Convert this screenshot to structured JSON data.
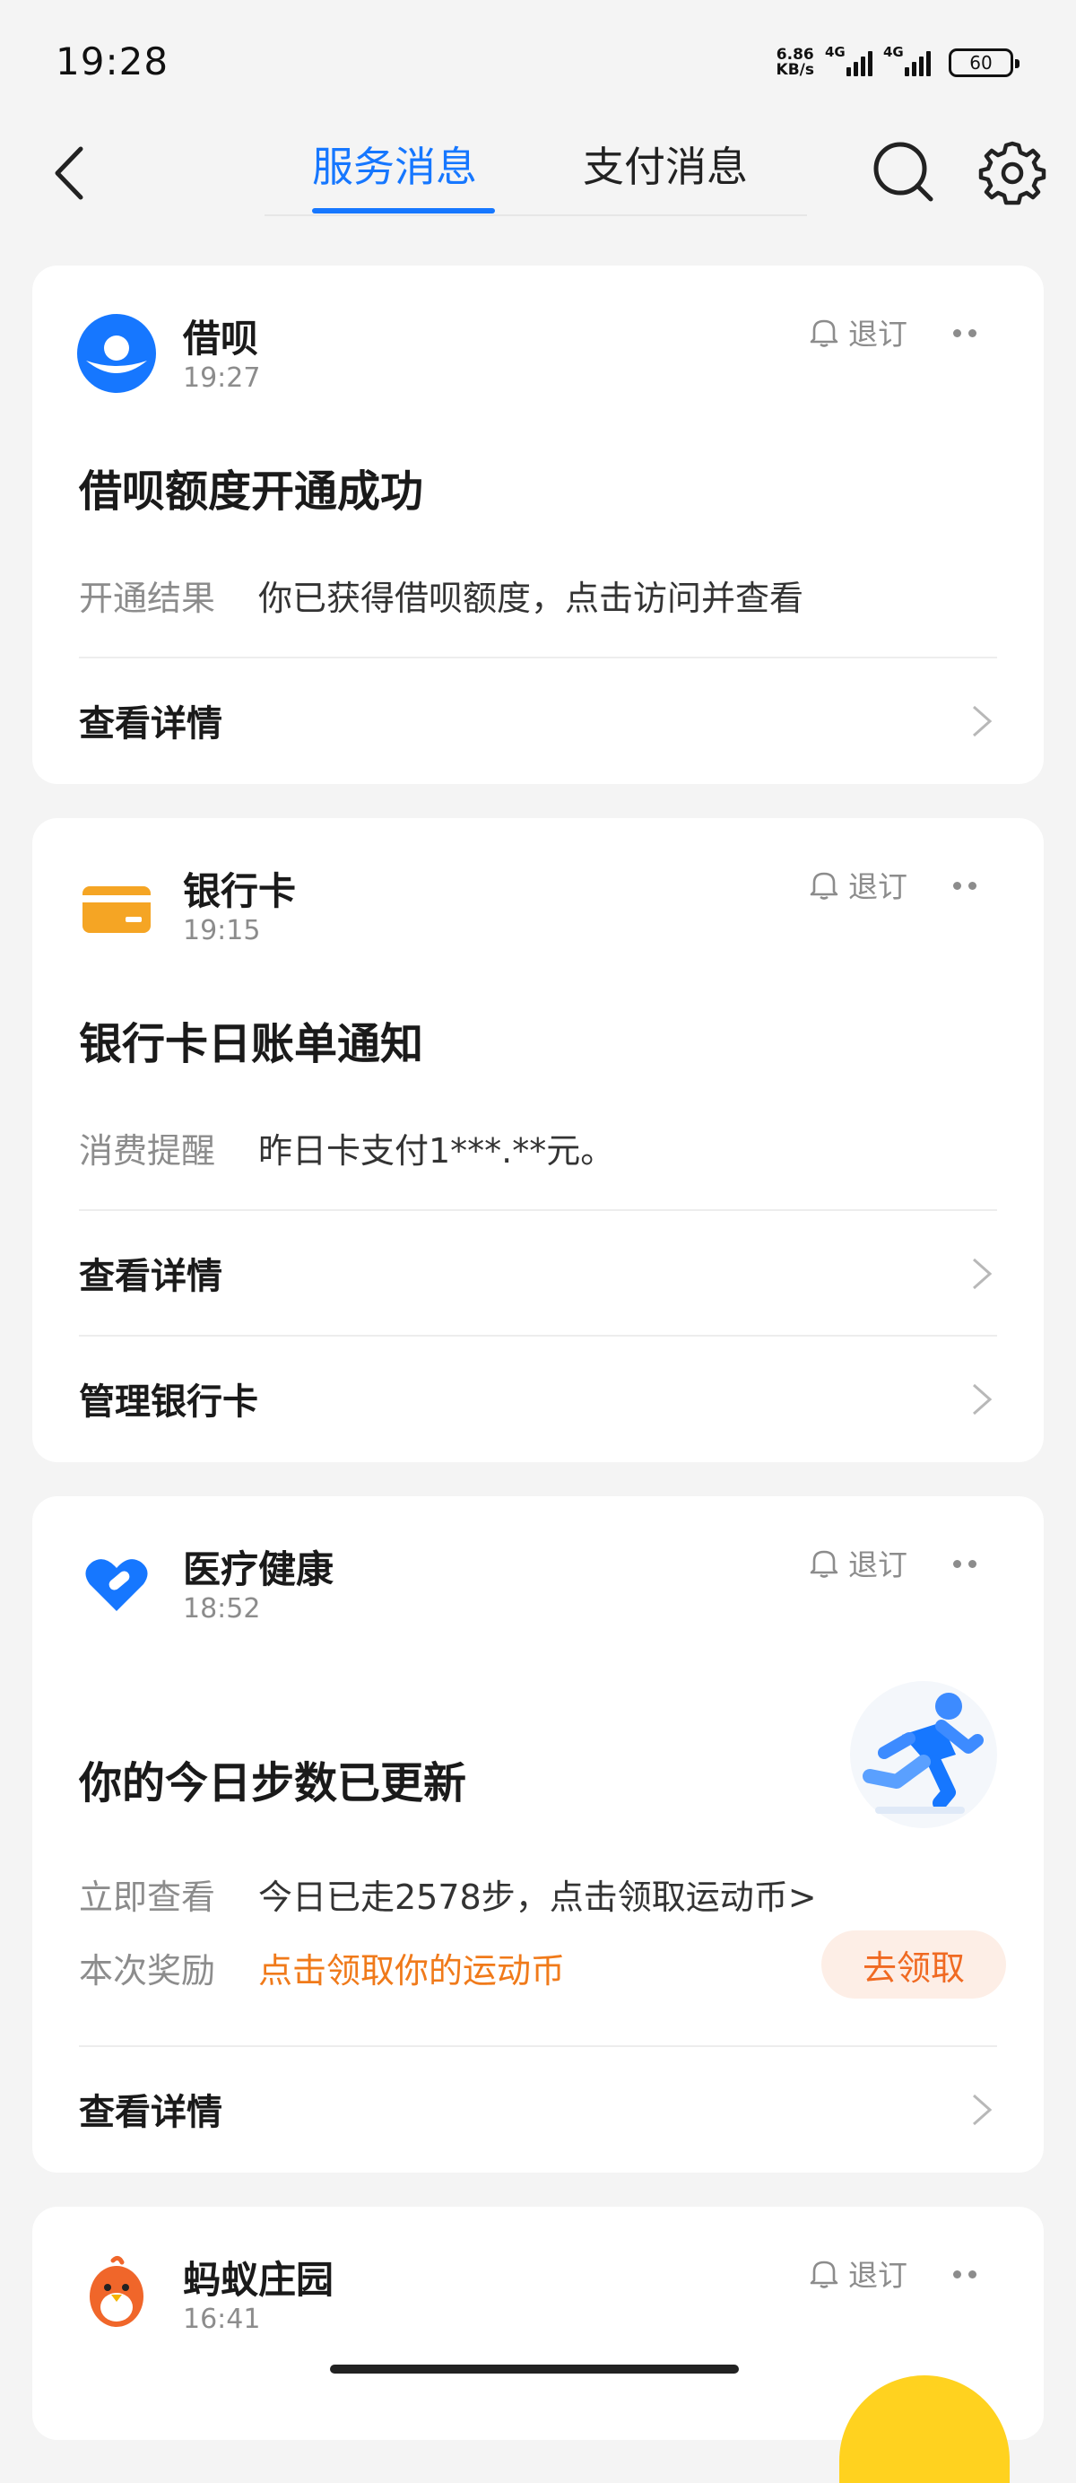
{
  "status_bar": {
    "time": "19:28",
    "net_speed_value": "6.86",
    "net_speed_unit": "KB/s",
    "signal_1_label": "4G",
    "signal_2_label": "4G",
    "battery": "60"
  },
  "nav": {
    "tabs": [
      {
        "label": "服务消息",
        "active": true
      },
      {
        "label": "支付消息",
        "active": false
      }
    ],
    "accent_color": "#1677ff"
  },
  "cards": [
    {
      "name": "借呗",
      "time": "19:27",
      "unsubscribe": "退订",
      "title": "借呗额度开通成功",
      "rows": [
        {
          "label": "开通结果",
          "value": "你已获得借呗额度，点击访问并查看"
        }
      ],
      "links": [
        "查看详情"
      ],
      "icon": "jiebei-logo-icon"
    },
    {
      "name": "银行卡",
      "time": "19:15",
      "unsubscribe": "退订",
      "title": "银行卡日账单通知",
      "rows": [
        {
          "label": "消费提醒",
          "value": "昨日卡支付1***.**元。"
        }
      ],
      "links": [
        "查看详情",
        "管理银行卡"
      ],
      "icon": "bank-card-icon"
    },
    {
      "name": "医疗健康",
      "time": "18:52",
      "unsubscribe": "退订",
      "title": "你的今日步数已更新",
      "rows": [
        {
          "label": "立即查看",
          "value": "今日已走2578步，点击领取运动币>"
        },
        {
          "label": "本次奖励",
          "value": "点击领取你的运动币"
        }
      ],
      "claim_button": "去领取",
      "links": [
        "查看详情"
      ],
      "icon": "health-heart-icon"
    },
    {
      "name": "蚂蚁庄园",
      "time": "16:41",
      "unsubscribe": "退订",
      "icon": "chick-icon"
    }
  ]
}
